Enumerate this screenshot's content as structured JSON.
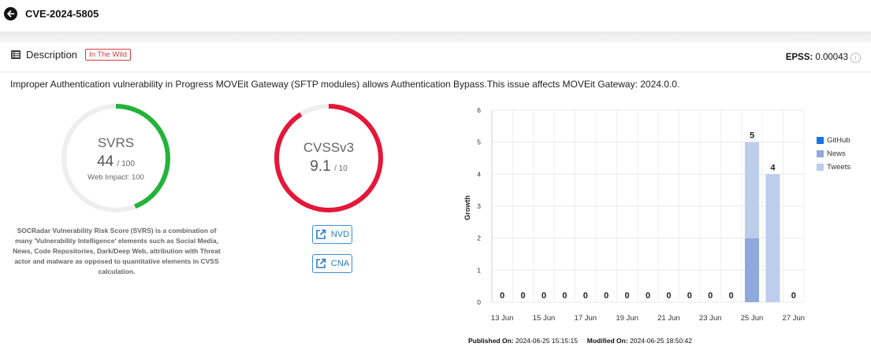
{
  "header": {
    "title": "CVE-2024-5805"
  },
  "description": {
    "label": "Description",
    "badge": "In The Wild",
    "epss_label": "EPSS:",
    "epss_value": "0.00043",
    "text": "Improper Authentication vulnerability in Progress MOVEit Gateway (SFTP modules) allows Authentication Bypass.This issue affects MOVEit Gateway: 2024.0.0."
  },
  "svrs": {
    "name": "SVRS",
    "score": "44",
    "max": "/ 100",
    "score_value": 44,
    "score_max": 100,
    "web_impact": "Web Impact: 100",
    "color": "#22b33a",
    "explain": "SOCRadar Vulnerability Risk Score (SVRS) is a combination of many 'Vulnerability Intelligence' elements such as Social Media, News, Code Repositories, Dark/Deep Web, attribution with Threat actor and malware as opposed to quantitative elements in CVSS calculation."
  },
  "cvss": {
    "name": "CVSSv3",
    "score": "9.1",
    "max": "/ 10",
    "score_value": 9.1,
    "score_max": 10,
    "color": "#e4173a"
  },
  "links": {
    "nvd": "NVD",
    "cna": "CNA"
  },
  "chart_data": {
    "type": "bar",
    "stacked": true,
    "categories": [
      "13 Jun",
      "14 Jun",
      "15 Jun",
      "16 Jun",
      "17 Jun",
      "18 Jun",
      "19 Jun",
      "20 Jun",
      "21 Jun",
      "22 Jun",
      "23 Jun",
      "24 Jun",
      "25 Jun",
      "26 Jun",
      "27 Jun"
    ],
    "x_tick_labels": [
      "13 Jun",
      "15 Jun",
      "17 Jun",
      "19 Jun",
      "21 Jun",
      "23 Jun",
      "25 Jun",
      "27 Jun"
    ],
    "series": [
      {
        "name": "GitHub",
        "color": "#1a73e8",
        "values": [
          0,
          0,
          0,
          0,
          0,
          0,
          0,
          0,
          0,
          0,
          0,
          0,
          0,
          0,
          0
        ]
      },
      {
        "name": "News",
        "color": "#8fa9dc",
        "values": [
          0,
          0,
          0,
          0,
          0,
          0,
          0,
          0,
          0,
          0,
          0,
          0,
          2,
          0,
          0
        ]
      },
      {
        "name": "Tweets",
        "color": "#bdcdec",
        "values": [
          0,
          0,
          0,
          0,
          0,
          0,
          0,
          0,
          0,
          0,
          0,
          0,
          3,
          4,
          0
        ]
      }
    ],
    "totals": [
      0,
      0,
      0,
      0,
      0,
      0,
      0,
      0,
      0,
      0,
      0,
      0,
      5,
      4,
      0
    ],
    "ylabel": "Growth",
    "ylim": [
      0,
      6
    ],
    "yticks": [
      0,
      1,
      2,
      3,
      4,
      5,
      6
    ],
    "legend_position": "right"
  },
  "footer": {
    "published_label": "Published On:",
    "published_value": "2024-06-25 15:15:15",
    "modified_label": "Modified On:",
    "modified_value": "2024-06-25 18:50:42"
  }
}
